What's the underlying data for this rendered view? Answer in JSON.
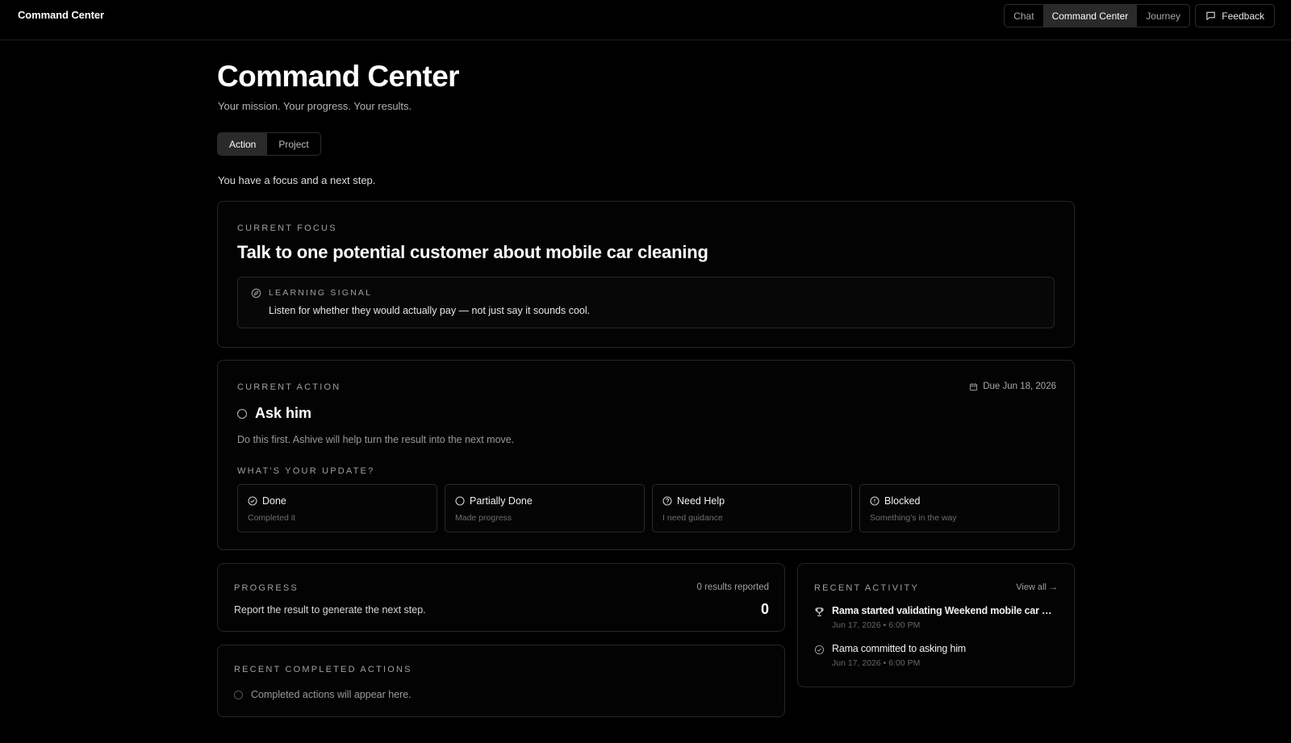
{
  "app": {
    "brand": "Command Center"
  },
  "nav": {
    "items": [
      "Chat",
      "Command Center",
      "Journey"
    ],
    "active": "Command Center",
    "feedback_label": "Feedback"
  },
  "header": {
    "title": "Command Center",
    "subtitle": "Your mission. Your progress. Your results.",
    "tabs": [
      "Action",
      "Project"
    ],
    "active_tab": "Action",
    "intro": "You have a focus and a next step."
  },
  "focus": {
    "eyebrow": "CURRENT FOCUS",
    "title": "Talk to one potential customer about mobile car cleaning",
    "signal_label": "LEARNING SIGNAL",
    "signal_text": "Listen for whether they would actually pay — not just say it sounds cool.",
    "signal_icon": "compass-icon"
  },
  "action": {
    "eyebrow": "CURRENT ACTION",
    "due": "Due Jun 18, 2026",
    "title": "Ask him",
    "description": "Do this first. Ashive will help turn the result into the next move.",
    "update_label": "WHAT'S YOUR UPDATE?",
    "options": [
      {
        "label": "Done",
        "sub": "Completed it",
        "icon": "check-circle-icon"
      },
      {
        "label": "Partially Done",
        "sub": "Made progress",
        "icon": "half-circle-icon"
      },
      {
        "label": "Need Help",
        "sub": "I need guidance",
        "icon": "help-circle-icon"
      },
      {
        "label": "Blocked",
        "sub": "Something's in the way",
        "icon": "alert-circle-icon"
      }
    ]
  },
  "progress": {
    "eyebrow": "PROGRESS",
    "results_reported": "0 results reported",
    "text": "Report the result to generate the next step.",
    "count": "0"
  },
  "completed": {
    "eyebrow": "RECENT COMPLETED ACTIONS",
    "empty_text": "Completed actions will appear here."
  },
  "activity": {
    "eyebrow": "RECENT ACTIVITY",
    "view_all": "View all →",
    "items": [
      {
        "text": "Rama started validating Weekend mobile car was...",
        "date": "Jun 17, 2026 • 6:00 PM",
        "icon": "trophy-icon"
      },
      {
        "text": "Rama committed to asking him",
        "date": "Jun 17, 2026 • 6:00 PM",
        "icon": "check-circle-icon"
      }
    ]
  },
  "colors": {
    "background": "#000000",
    "card_border": "#262626",
    "active_segment": "#2a2a2a",
    "text": "#e8e8e8"
  }
}
